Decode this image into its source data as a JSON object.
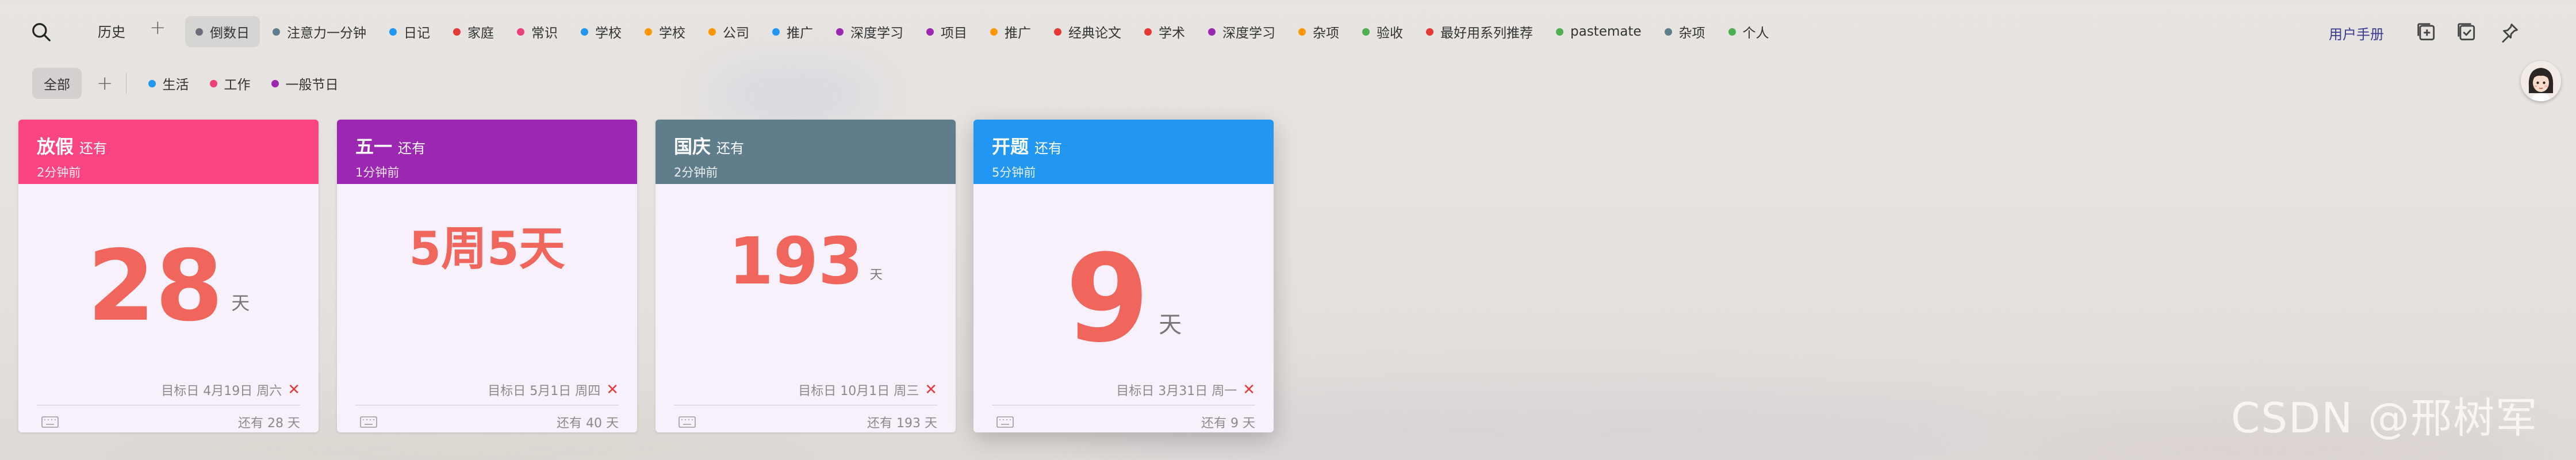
{
  "colors": {
    "card_pink": "#fb4482",
    "card_purple": "#9c27b0",
    "card_slate": "#607d8b",
    "card_blue": "#2196f3",
    "number_red": "#f1665c"
  },
  "topbar": {
    "search_icon": "search-icon",
    "history_label": "历史",
    "add_label": "+",
    "tags": [
      {
        "label": "倒数日",
        "color": "#6e6e78",
        "active": true
      },
      {
        "label": "注意力一分钟",
        "color": "#607d8b"
      },
      {
        "label": "日记",
        "color": "#2196f3"
      },
      {
        "label": "家庭",
        "color": "#e53935"
      },
      {
        "label": "常识",
        "color": "#ec407a"
      },
      {
        "label": "学校",
        "color": "#2196f3"
      },
      {
        "label": "学校",
        "color": "#ff9800"
      },
      {
        "label": "公司",
        "color": "#ff9800"
      },
      {
        "label": "推广",
        "color": "#2196f3"
      },
      {
        "label": "深度学习",
        "color": "#9c27b0"
      },
      {
        "label": "项目",
        "color": "#9c27b0"
      },
      {
        "label": "推广",
        "color": "#ff9800"
      },
      {
        "label": "经典论文",
        "color": "#e53935"
      },
      {
        "label": "学术",
        "color": "#e53935"
      },
      {
        "label": "深度学习",
        "color": "#9c27b0"
      },
      {
        "label": "杂项",
        "color": "#ff9800"
      },
      {
        "label": "验收",
        "color": "#4caf50"
      },
      {
        "label": "最好用系列推荐",
        "color": "#e53935"
      },
      {
        "label": "pastemate",
        "color": "#4caf50"
      },
      {
        "label": "杂项",
        "color": "#607d8b"
      },
      {
        "label": "个人",
        "color": "#4caf50"
      }
    ],
    "manual_label": "用户手册",
    "tools": [
      "add-box-icon",
      "checklist-icon",
      "pin-icon"
    ]
  },
  "subbar": {
    "all_label": "全部",
    "add_label": "+",
    "tags": [
      {
        "label": "生活",
        "color": "#2196f3"
      },
      {
        "label": "工作",
        "color": "#ec407a"
      },
      {
        "label": "一般节日",
        "color": "#9c27b0"
      }
    ]
  },
  "cards": [
    {
      "title": "放假",
      "suffix": "还有",
      "subtitle": "2分钟前",
      "number": "28",
      "unit": "天",
      "target": "目标日 4月19日 周六",
      "footer": "还有 28 天",
      "color": "#fb4482"
    },
    {
      "title": "五一",
      "suffix": "还有",
      "subtitle": "1分钟前",
      "number": "5周5天",
      "unit": "",
      "target": "目标日 5月1日 周四",
      "footer": "还有 40 天",
      "color": "#9c27b0"
    },
    {
      "title": "国庆",
      "suffix": "还有",
      "subtitle": "2分钟前",
      "number": "193",
      "unit": "天",
      "target": "目标日 10月1日 周三",
      "footer": "还有 193 天",
      "color": "#607d8b"
    },
    {
      "title": "开题",
      "suffix": "还有",
      "subtitle": "5分钟前",
      "number": "9",
      "unit": "天",
      "target": "目标日 3月31日 周一",
      "footer": "还有 9 天",
      "color": "#2196f3"
    }
  ],
  "close_mark": "✕",
  "watermark": "CSDN @邢树军"
}
